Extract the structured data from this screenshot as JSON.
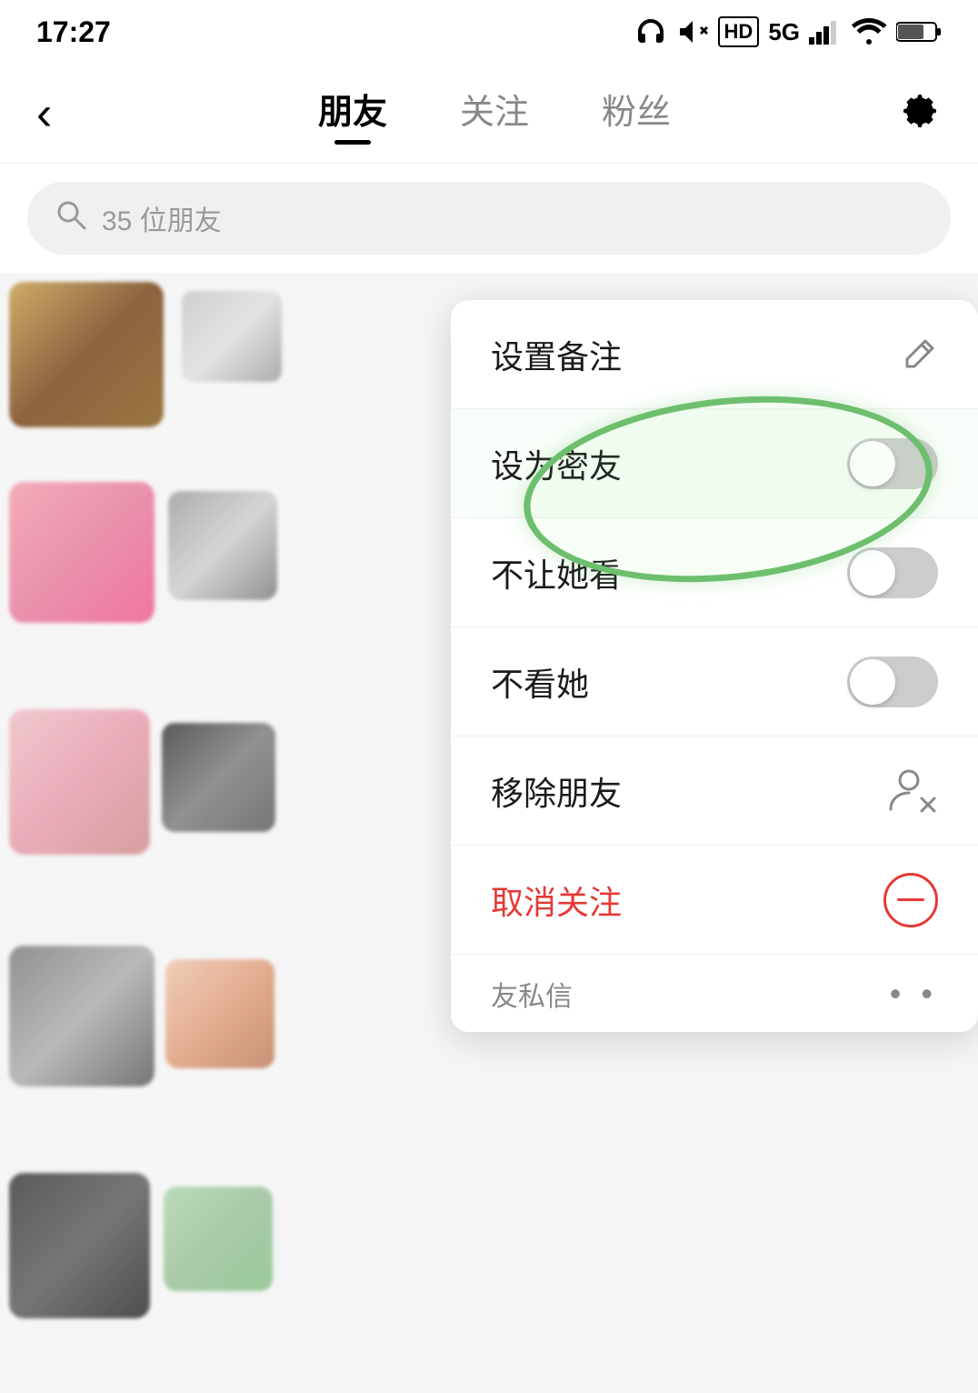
{
  "statusBar": {
    "time": "17:27",
    "icons": "headphone mute hd 5g signal wifi battery"
  },
  "navBar": {
    "backLabel": "‹",
    "tabs": [
      {
        "label": "朋友",
        "active": true
      },
      {
        "label": "关注",
        "active": false
      },
      {
        "label": "粉丝",
        "active": false
      }
    ],
    "settingsLabel": "⚙"
  },
  "search": {
    "placeholder": "35 位朋友"
  },
  "contextMenu": {
    "items": [
      {
        "id": "set-remark",
        "label": "设置备注",
        "iconType": "pencil"
      },
      {
        "id": "set-close-friend",
        "label": "设为密友",
        "iconType": "toggle",
        "circled": true
      },
      {
        "id": "hide-from-her",
        "label": "不让她看",
        "iconType": "toggle"
      },
      {
        "id": "hide-her",
        "label": "不看她",
        "iconType": "toggle"
      },
      {
        "id": "remove-friend",
        "label": "移除朋友",
        "iconType": "remove"
      },
      {
        "id": "unfollow",
        "label": "取消关注",
        "iconType": "minus",
        "red": true
      }
    ],
    "partialItem": {
      "label": "友私信",
      "dots": "• •"
    }
  },
  "annotation": {
    "circledItem": "设为密友"
  }
}
